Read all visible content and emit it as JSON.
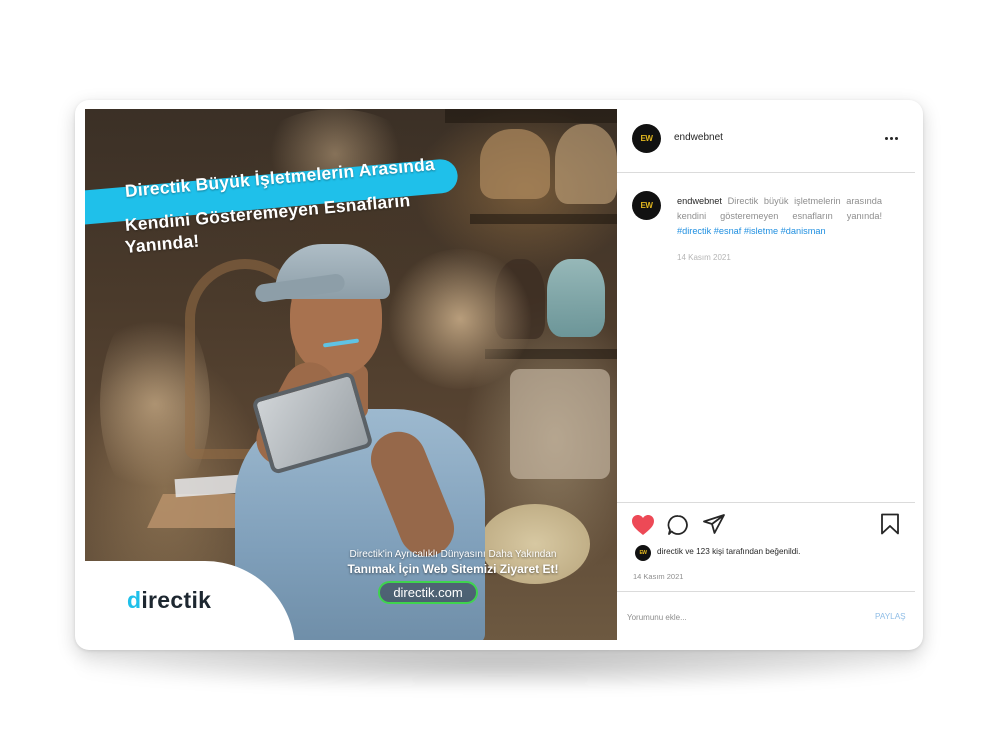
{
  "post": {
    "headline": {
      "line1": "Directik Büyük İşletmelerin Arasında",
      "line2": "Kendini Gösteremeyen Esnafların",
      "line3": "Yanında!"
    },
    "brand_logo": "directik",
    "cta": {
      "small": "Directik'in Ayrıcalıklı Dünyasını Daha Yakından",
      "big": "Tanımak İçin Web Sitemizi Ziyaret Et!",
      "url": "directik.com"
    }
  },
  "sidebar": {
    "header": {
      "avatar_text": "EW",
      "username": "endwebnet"
    },
    "caption": {
      "avatar_text": "EW",
      "username": "endwebnet",
      "text": "Directik büyük işletmelerin arasında kendini gösteremeyen esnafların yanında!",
      "hashtags": "#directik #esnaf #isletme #danisman",
      "date": "14 Kasım 2021"
    },
    "actions": {
      "like_icon": "heart-icon",
      "comment_icon": "comment-icon",
      "share_icon": "send-icon",
      "save_icon": "bookmark-icon"
    },
    "likes": {
      "avatar_text": "EW",
      "text": "directik ve 123 kişi tarafından beğenildi."
    },
    "date": "14 Kasım 2021",
    "comment": {
      "placeholder": "Yorumunu ekle...",
      "share_label": "PAYLAŞ"
    }
  },
  "colors": {
    "accent_blue": "#1fc0ea",
    "like_red": "#ed4956",
    "link_blue": "#1f8fe0",
    "cta_green": "#3fd44e"
  }
}
